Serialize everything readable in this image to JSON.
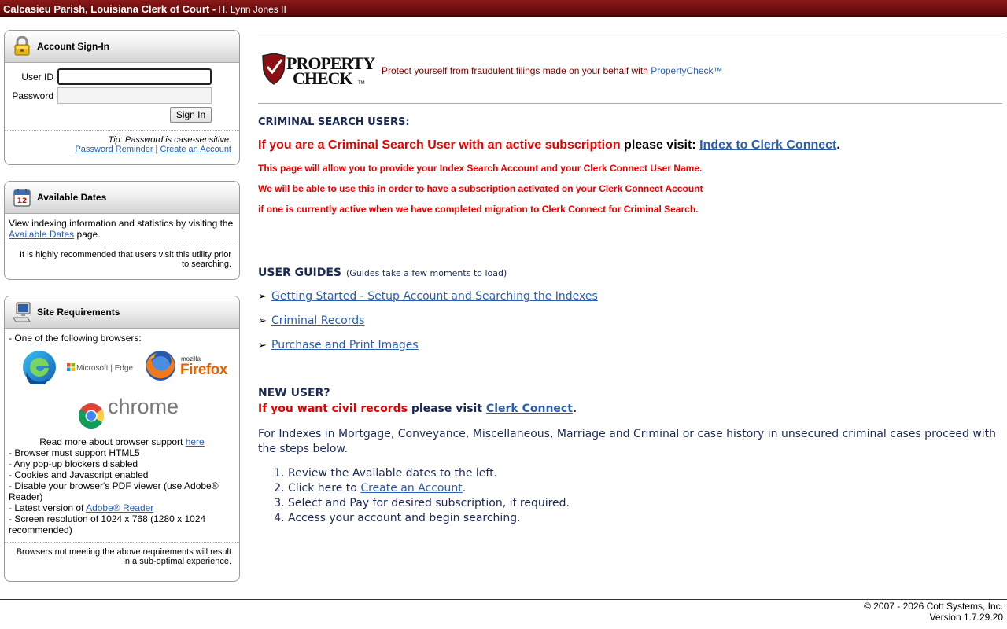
{
  "header": {
    "title": "Calcasieu Parish, Louisiana Clerk of Court -",
    "clerk": "H. Lynn Jones II"
  },
  "signin": {
    "title": "Account Sign-In",
    "icon": "padlock-icon",
    "user_label": "User ID",
    "password_label": "Password",
    "button": "Sign In",
    "tip": "Tip: Password is case-sensitive.",
    "reminder_link": "Password Reminder",
    "separator": "|",
    "create_link": "Create an Account"
  },
  "dates": {
    "title": "Available Dates",
    "icon": "calendar-icon",
    "text_before": "View indexing information and statistics by visiting the",
    "link": "Available Dates",
    "text_after": "page.",
    "note": "It is highly recommended that users visit this utility prior to searching."
  },
  "requirements": {
    "title": "Site Requirements",
    "icon": "computer-icon",
    "intro": "- One of the following browsers:",
    "edge_label": "Microsoft | Edge",
    "firefox_small": "mozilla",
    "firefox_label": "Firefox",
    "chrome_label": "chrome",
    "read_more": "Read more about browser support",
    "read_more_link": "here",
    "items": [
      "- Browser must support HTML5",
      "- Any pop-up blockers disabled",
      "- Cookies and Javascript enabled",
      "- Disable your browser's PDF viewer (use Adobe® Reader)"
    ],
    "latest_prefix": "- Latest version of",
    "latest_link": "Adobe® Reader",
    "resolution": "- Screen resolution of 1024 x 768 (1280 x 1024 recommended)",
    "note": "Browsers not meeting the above requirements will result in a sub-optimal experience."
  },
  "propertycheck": {
    "text": "Protect yourself from fraudulent filings made on your behalf with",
    "link": "PropertyCheck™"
  },
  "criminal": {
    "title": "CRIMINAL SEARCH USERS:",
    "main_red": "If you are a Criminal Search User with an active subscription",
    "main_black": "please visit:",
    "main_link": "Index to Clerk Connect",
    "main_end": ".",
    "lines": [
      "This page will allow you to provide your Index Search Account and your Clerk Connect User Name.",
      "We will be able to use this in order to have a subscription activated on your Clerk Connect Account",
      "if one is currently active when we have completed migration to Clerk Connect for Criminal Search."
    ]
  },
  "guides": {
    "title": "USER GUIDES",
    "note": "(Guides take a few moments to load)",
    "items": [
      " Getting Started - Setup Account and Searching the Indexes",
      "Criminal Records",
      "Purchase and Print Images"
    ]
  },
  "newuser": {
    "title": "NEW USER?",
    "red": "If you want civil records",
    "black": "please visit",
    "link": "Clerk Connect",
    "end": ".",
    "paragraph": "For Indexes in Mortgage, Conveyance, Miscellaneous, Marriage and Criminal or case history in unsecured criminal cases proceed with the steps below.",
    "step1": "Review the Available dates to the left.",
    "step2_prefix": "Click here to",
    "step2_link": "Create an Account",
    "step2_end": ".",
    "step3": "Select and Pay for desired subscription, if required.",
    "step4": "Access your account and begin searching."
  },
  "footer": {
    "copyright": "© 2007 - 2026 Cott Systems, Inc.",
    "version": "Version 1.7.29.20"
  },
  "colors": {
    "header_bar": "#6e0c0c",
    "alert_red": "#e60000",
    "navy": "#1b2a55",
    "link_blue": "#2a5db0"
  }
}
